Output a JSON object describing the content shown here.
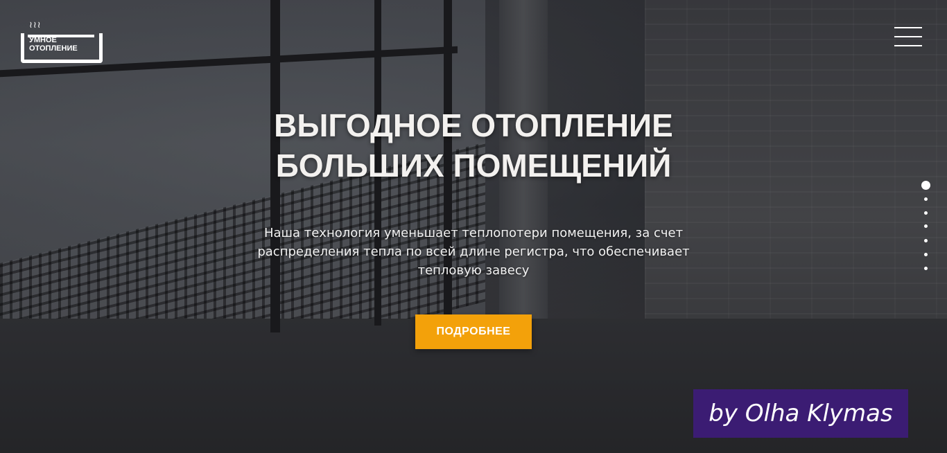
{
  "logo": {
    "steam": "≀≀≀",
    "line1": "УМНОЕ",
    "line2": "ОТОПЛЕНИЕ"
  },
  "hero": {
    "title_line1": "ВЫГОДНОЕ ОТОПЛЕНИЕ",
    "title_line2": "БОЛЬШИХ ПОМЕЩЕНИЙ",
    "description": "Наша технология уменьшает теплопотери помещения, за счет распределения тепла по всей длине регистра, что обеспечивает тепловую завесу",
    "cta_label": "ПОДРОБНЕЕ"
  },
  "slider": {
    "active_index": 0,
    "count": 7
  },
  "watermark": {
    "text": "by Olha Klymas"
  },
  "colors": {
    "accent": "#f3a10a",
    "watermark_bg": "#3b1c73",
    "text": "#f3f1ef"
  },
  "icons": {
    "menu": "hamburger-icon",
    "logo": "radiator-logo-icon"
  }
}
